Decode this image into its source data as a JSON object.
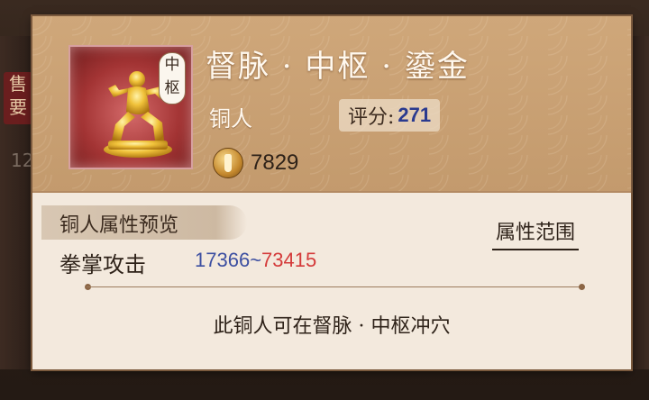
{
  "background": {
    "left_badge_text": "售\n要",
    "left_number": "12"
  },
  "item": {
    "title": "督脉 · 中枢 · 鎏金",
    "tag": "中枢",
    "type": "铜人",
    "score_label": "评分:",
    "score_value": "271",
    "power_value": "7829"
  },
  "section": {
    "title": "铜人属性预览",
    "range_button": "属性范围",
    "attribute": {
      "name": "拳掌攻击",
      "min": "17366",
      "separator": "~",
      "max": "73415"
    },
    "note": "此铜人可在督脉 · 中枢冲穴"
  },
  "colors": {
    "min_value": "#3c4fa1",
    "max_value": "#d43a3a",
    "score_value": "#2a3a8f",
    "header_bg": "#c79d70",
    "body_bg": "#f3e9dd"
  }
}
